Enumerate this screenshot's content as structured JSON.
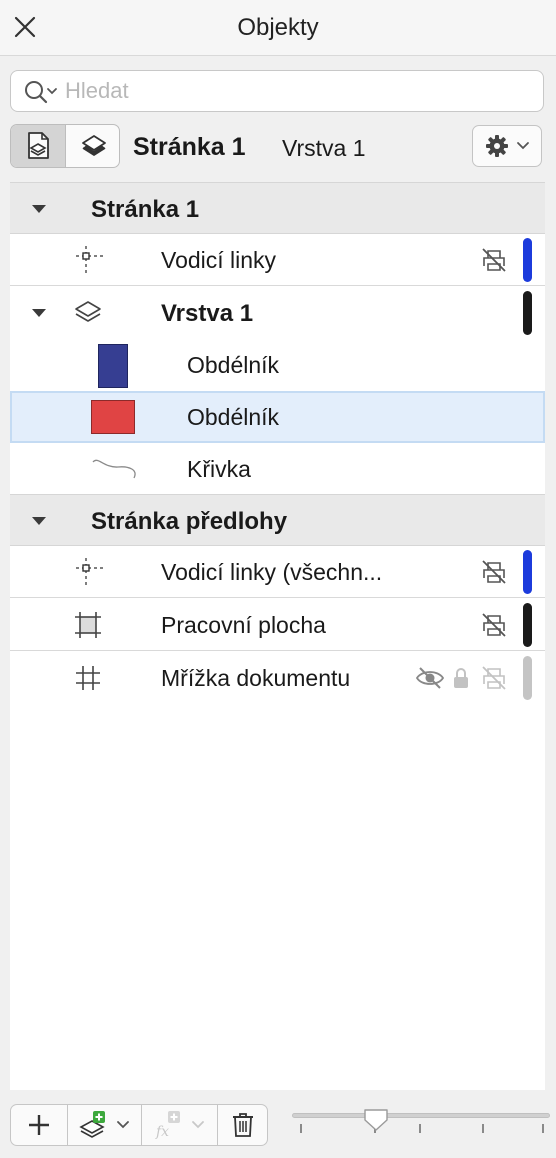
{
  "window": {
    "title": "Objekty"
  },
  "search": {
    "placeholder": "Hledat",
    "value": ""
  },
  "toolbar": {
    "page_name": "Stránka 1",
    "layer_name": "Vrstva 1"
  },
  "tree": {
    "page_header": "Stránka 1",
    "guides": "Vodicí linky",
    "layer": "Vrstva 1",
    "rect_blue": "Obdélník",
    "rect_red": "Obdélník",
    "curve": "Křivka",
    "master_header": "Stránka předlohy",
    "guides_all": "Vodicí linky (všechn...",
    "artboard": "Pracovní plocha",
    "grid": "Mřížka dokumentu"
  },
  "colors": {
    "status_blue": "#1c3bdc",
    "status_black": "#1a1a1a",
    "status_gray": "#c4c4c4",
    "rect_blue_fill": "#363e92",
    "rect_red_fill": "#e04444",
    "selection": "#e3eefb"
  },
  "icons": {
    "close": "close-icon",
    "search": "search-icon",
    "pages_view": "page-layers-icon",
    "layers_view": "layers-icon",
    "settings": "gear-icon",
    "add": "plus-icon",
    "new_layer": "add-layer-icon",
    "effects": "effects-icon",
    "delete": "trash-icon"
  }
}
